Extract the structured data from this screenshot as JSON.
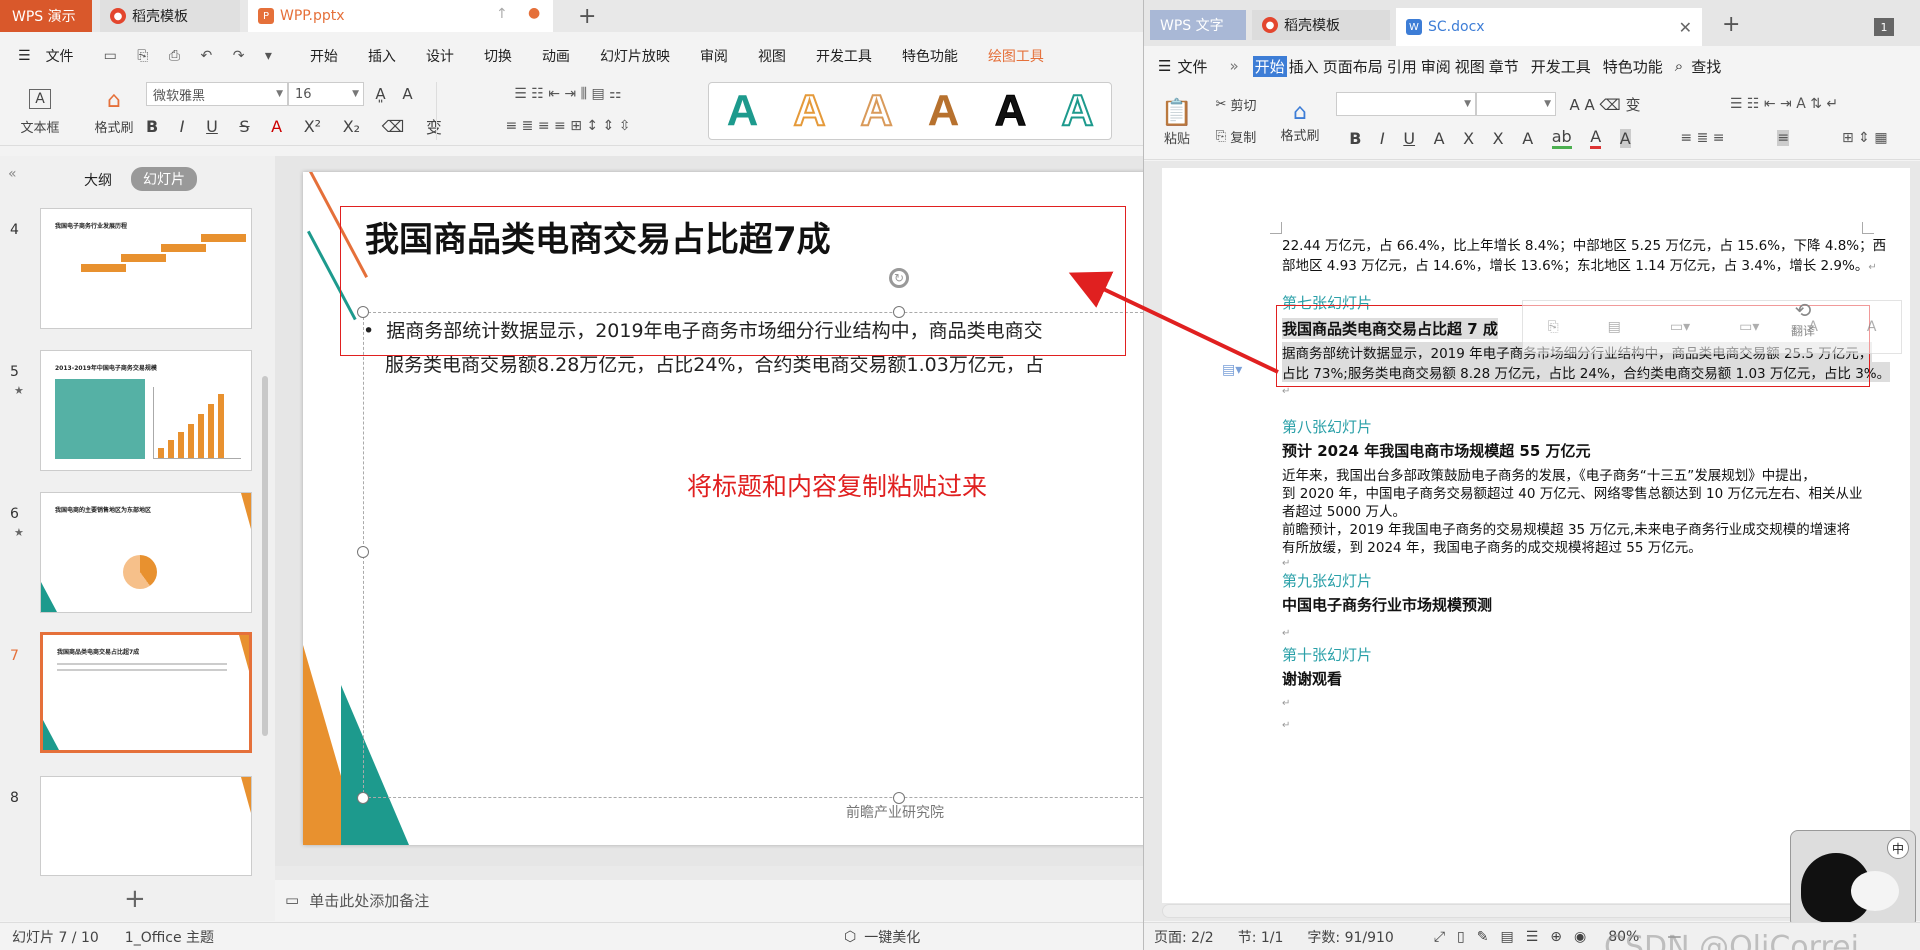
{
  "wpp": {
    "app_tab": "WPS 演示",
    "tabs": [
      "稻壳模板",
      "WPP.pptx"
    ],
    "menu": [
      "文件",
      "开始",
      "插入",
      "设计",
      "切换",
      "动画",
      "幻灯片放映",
      "审阅",
      "视图",
      "开发工具",
      "特色功能",
      "绘图工具"
    ],
    "ribbon": {
      "textbox": "文本框",
      "format_painter": "格式刷",
      "font": "微软雅黑",
      "size": "16"
    },
    "panel_tabs": [
      "大纲",
      "幻灯片"
    ],
    "thumbs": [
      {
        "num": "4",
        "title": "我国电子商务行业发展历程",
        "star": false
      },
      {
        "num": "5",
        "title": "2013-2019年中国电子商务交易规模",
        "star": true
      },
      {
        "num": "6",
        "title": "我国电商的主要销售地区为东部地区",
        "star": true
      },
      {
        "num": "7",
        "title": "我国商品类电商交易占比超7成",
        "star": false
      },
      {
        "num": "8",
        "title": "",
        "star": false
      }
    ],
    "slide": {
      "title": "我国商品类电商交易占比超7成",
      "bullet_line1": "据商务部统计数据显示，2019年电子商务市场细分行业结构中，商品类电商交",
      "bullet_line2": "服务类电商交易额8.28万亿元，占比24%，合约类电商交易额1.03万亿元，占",
      "annotation": "将标题和内容复制粘贴过来",
      "source": "前瞻产业研究院"
    },
    "notes_placeholder": "单击此处添加备注",
    "status": {
      "slide": "幻灯片 7 / 10",
      "theme": "1_Office 主题",
      "beautify": "一键美化"
    }
  },
  "wps": {
    "app_tab": "WPS 文字",
    "tabs": [
      "稻壳模板",
      "SC.docx"
    ],
    "menu": [
      "文件",
      "开始",
      "插入",
      "页面布局",
      "引用",
      "审阅",
      "视图",
      "章节",
      "开发工具",
      "特色功能",
      "查找"
    ],
    "ribbon": {
      "paste": "粘贴",
      "cut": "剪切",
      "copy": "复制",
      "format_painter": "格式刷",
      "translate": "翻译"
    },
    "doc": {
      "p1": "22.44 万亿元，占 66.4%，比上年增长 8.4%；中部地区 5.25 万亿元，占 15.6%，下降 4.8%；西",
      "p2": "部地区 4.93 万亿元，占 14.6%，增长 13.6%；东北地区 1.14 万亿元，占 3.4%，增长 2.9%。",
      "h7": "第七张幻灯片",
      "t7": "我国商品类电商交易占比超 7 成",
      "b7a": "据商务部统计数据显示，2019 年电子商务市场细分行业结构中，商品类电商交易额 25.5 万亿元，",
      "b7b": "占比 73%;服务类电商交易额 8.28 万亿元，占比 24%，合约类电商交易额 1.03 万亿元，占比 3%。",
      "h8": "第八张幻灯片",
      "t8": "预计 2024 年我国电商市场规模超 55 万亿元",
      "b8a": "近年来，我国出台多部政策鼓励电子商务的发展，《电子商务“十三五”发展规划》中提出，",
      "b8b": "到 2020 年，中国电子商务交易额超过 40 万亿元、网络零售总额达到 10 万亿元左右、相关从业",
      "b8c": "者超过 5000 万人。",
      "b8d": "前瞻预计，2019 年我国电子商务的交易规模超 35 万亿元,未来电子商务行业成交规模的增速将",
      "b8e": "有所放缓，到 2024 年，我国电子商务的成交规模将超过 55 万亿元。",
      "h9": "第九张幻灯片",
      "t9": "中国电子商务行业市场规模预测",
      "h10": "第十张幻灯片",
      "t10": "谢谢观看"
    },
    "status": {
      "page": "页面: 2/2",
      "section": "节: 1/1",
      "words": "字数: 91/910",
      "zoom": "80%"
    },
    "ime": "中",
    "watermark": "CSDN @OliCorrei"
  },
  "colors": {
    "accent_orange": "#e5703a",
    "teal": "#1d9a8d",
    "red": "#e02020",
    "wps_blue": "#3d7dd6"
  }
}
